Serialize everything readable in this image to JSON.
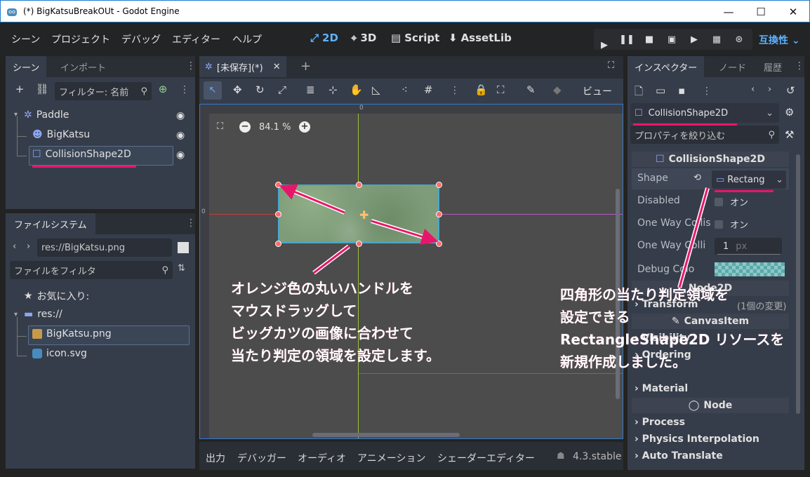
{
  "window": {
    "title": "(*) BigKatsuBreakOUt - Godot Engine",
    "min": "—",
    "max": "☐",
    "close": "✕"
  },
  "menu": [
    "シーン",
    "プロジェクト",
    "デバッグ",
    "エディター",
    "ヘルプ"
  ],
  "modes": {
    "2d": "2D",
    "3d": "3D",
    "script": "Script",
    "assetlib": "AssetLib"
  },
  "renderer": "互換性",
  "scene_dock": {
    "tabs": [
      "シーン",
      "インポート"
    ],
    "filter_placeholder": "フィルター: 名前",
    "nodes": [
      {
        "name": "Paddle",
        "icon": "node2d-icon"
      },
      {
        "name": "BigKatsu",
        "icon": "sprite-icon"
      },
      {
        "name": "CollisionShape2D",
        "icon": "collision-shape-icon"
      }
    ]
  },
  "filesystem": {
    "tab": "ファイルシステム",
    "path": "res://BigKatsu.png",
    "filter_placeholder": "ファイルをフィルタ",
    "favorites": "お気に入り:",
    "root": "res://",
    "files": [
      "BigKatsu.png",
      "icon.svg"
    ]
  },
  "viewport": {
    "tab": "[未保存](*)",
    "zoom": "84.1 %",
    "view_button": "ビュー",
    "ruler_zero_top": "0",
    "ruler_zero_left": "0"
  },
  "bottom_tabs": [
    "出力",
    "デバッガー",
    "オーディオ",
    "アニメーション",
    "シェーダーエディター"
  ],
  "version": "4.3.stable",
  "inspector": {
    "tabs": [
      "インスペクター",
      "ノード",
      "履歴"
    ],
    "node": "CollisionShape2D",
    "filter_placeholder": "プロパティを絞り込む",
    "section": "CollisionShape2D",
    "props": {
      "shape_label": "Shape",
      "shape_value": "Rectang",
      "disabled_label": "Disabled",
      "disabled_value": "オン",
      "oneway_label": "One Way Collis",
      "oneway_value": "オン",
      "oneway_margin_label": "One Way Colli",
      "oneway_margin_value": "1",
      "oneway_margin_unit": "px",
      "debug_color_label": "Debug Colo"
    },
    "node2d_section": "Node2D",
    "transform": "Transform",
    "transform_note": "(1個の変更)",
    "canvasitem_section": "CanvasItem",
    "visibility": "Visibility",
    "ordering": "Ordering",
    "material": "Material",
    "node_section": "Node",
    "process": "Process",
    "physics": "Physics Interpolation",
    "autotranslate": "Auto Translate"
  },
  "annotations": {
    "left": [
      "オレンジ色の丸いハンドルを",
      "マウスドラッグして",
      "ビッグカツの画像に合わせて",
      "当たり判定の領域を設定します。"
    ],
    "right": [
      "四角形の当たり判定領域を",
      "設定できる",
      "RectangleShape2D リソースを",
      "新規作成しました。"
    ]
  },
  "colors": {
    "accent": "#5fb2ff",
    "annotation": "#e8166b",
    "handle": "#ff6b6b"
  }
}
